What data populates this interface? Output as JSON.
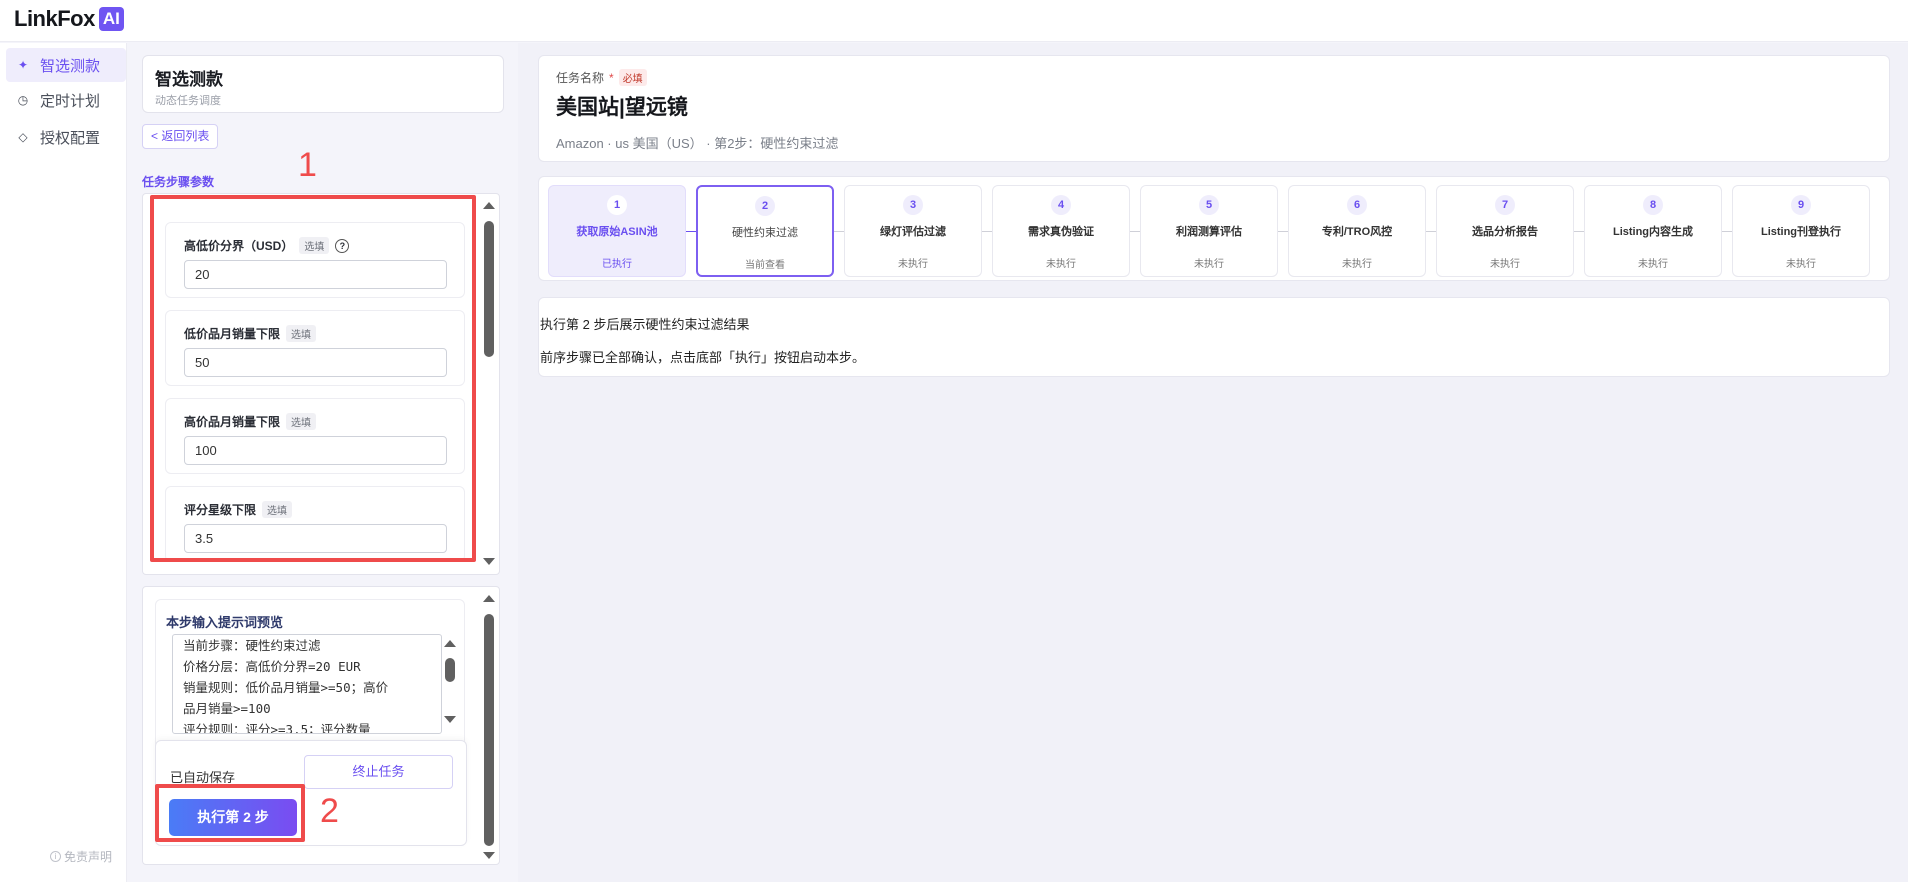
{
  "app": {
    "logo_text": "LinkFox",
    "logo_badge": "AI"
  },
  "sidebar": {
    "items": [
      {
        "label": "智选测款",
        "icon": "sparkle-icon",
        "active": true
      },
      {
        "label": "定时计划",
        "icon": "clock-icon",
        "active": false
      },
      {
        "label": "授权配置",
        "icon": "diamond-icon",
        "active": false
      }
    ],
    "disclaimer": "免责声明"
  },
  "task_card": {
    "title": "智选测款",
    "subtitle": "动态任务调度"
  },
  "back_button": "< 返回列表",
  "section_label": "任务步骤参数",
  "params": [
    {
      "label": "高低价分界（USD）",
      "tag": "选填",
      "help": "?",
      "value": "20"
    },
    {
      "label": "低价品月销量下限",
      "tag": "选填",
      "value": "50"
    },
    {
      "label": "高价品月销量下限",
      "tag": "选填",
      "value": "100"
    },
    {
      "label": "评分星级下限",
      "tag": "选填",
      "value": "3.5"
    }
  ],
  "prompt_preview": {
    "title": "本步输入提示词预览",
    "lines": [
      "当前步骤：硬性约束过滤",
      "价格分层：高低价分界=20 EUR",
      "销量规则：低价品月销量>=50；高价",
      "品月销量>=100",
      "评分规则：评分>=3.5；评分数量"
    ]
  },
  "bottom_actions": {
    "autosave": "已自动保存",
    "stop": "终止任务",
    "execute": "执行第 2 步"
  },
  "annotations": {
    "one": "1",
    "two": "2"
  },
  "task_info": {
    "label": "任务名称",
    "required_star": "*",
    "required_tag": "必填",
    "name": "美国站|望远镜",
    "sub": "Amazon · us 美国（US） · 第2步：硬性约束过滤"
  },
  "steps": [
    {
      "num": "1",
      "title": "获取原始ASIN池",
      "status": "已执行",
      "state": "done"
    },
    {
      "num": "2",
      "title": "硬性约束过滤",
      "status": "当前查看",
      "state": "current"
    },
    {
      "num": "3",
      "title": "绿灯评估过滤",
      "status": "未执行",
      "state": "todo"
    },
    {
      "num": "4",
      "title": "需求真伪验证",
      "status": "未执行",
      "state": "todo"
    },
    {
      "num": "5",
      "title": "利润测算评估",
      "status": "未执行",
      "state": "todo"
    },
    {
      "num": "6",
      "title": "专利/TRO风控",
      "status": "未执行",
      "state": "todo"
    },
    {
      "num": "7",
      "title": "选品分析报告",
      "status": "未执行",
      "state": "todo"
    },
    {
      "num": "8",
      "title": "Listing内容生成",
      "status": "未执行",
      "state": "todo"
    },
    {
      "num": "9",
      "title": "Listing刊登执行",
      "status": "未执行",
      "state": "todo"
    }
  ],
  "result": {
    "line1": "执行第 2 步后展示硬性约束过滤结果",
    "line2": "前序步骤已全部确认，点击底部「执行」按钮启动本步。"
  },
  "colors": {
    "accent": "#6a4ff0",
    "annotation": "#ef4b4b"
  }
}
